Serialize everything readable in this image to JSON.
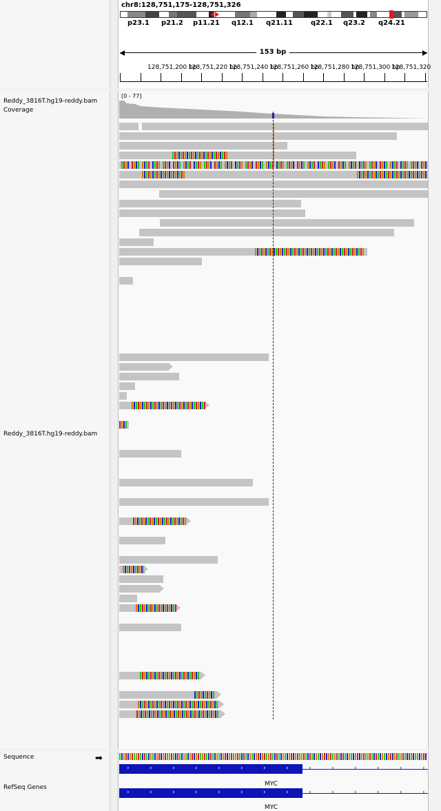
{
  "header": {
    "locus": "chr8:128,751,175-128,751,326",
    "span": "153 bp",
    "bands": [
      "p23.1",
      "p21.2",
      "p11.21",
      "q12.1",
      "q21.11",
      "q22.1",
      "q23.2",
      "q24.21"
    ],
    "ruler_ticks": [
      "128,751,200 bp",
      "128,751,220 bp",
      "128,751,240 bp",
      "128,751,260 bp",
      "128,751,280 bp",
      "128,751,300 bp",
      "128,751,320"
    ]
  },
  "tracks": {
    "coverage_name": "Reddy_3816T.hg19-reddy.bam Coverage",
    "coverage_range": "[0 - 77]",
    "alignment_name": "Reddy_3816T.hg19-reddy.bam",
    "sequence_name": "Sequence",
    "sequence_arrow": "➡",
    "refseq_name": "RefSeq Genes",
    "gene_label": "MYC"
  },
  "colors": {
    "read": "#c4c4c4",
    "gene": "#0d14b8",
    "mismatch_A": "#1ec81e",
    "mismatch_C": "#1e1ec8",
    "mismatch_G": "#d18000",
    "mismatch_T": "#d21e1e",
    "highlight_band": "#e0191b"
  }
}
